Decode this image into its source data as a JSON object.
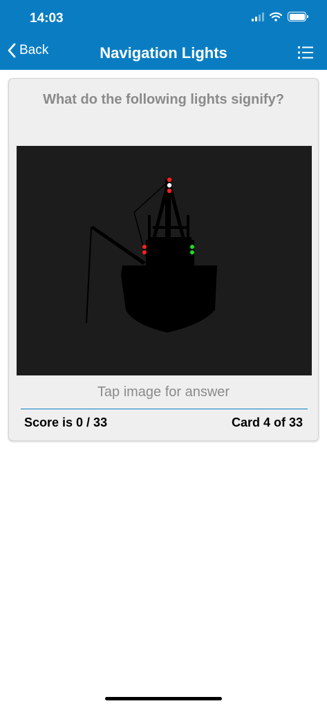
{
  "status_bar": {
    "time": "14:03"
  },
  "nav": {
    "back_label": "Back",
    "title": "Navigation Lights"
  },
  "card": {
    "question": "What do the following lights signify?",
    "tap_hint": "Tap image for answer",
    "score": "Score is 0 / 33",
    "card_position": "Card 4 of 33"
  },
  "colors": {
    "header_blue": "#0a7dc2",
    "card_bg": "#efefef",
    "image_bg": "#1c1c1c",
    "light_red": "#ff2020",
    "light_green": "#22dd22",
    "light_white": "#ffffff"
  }
}
